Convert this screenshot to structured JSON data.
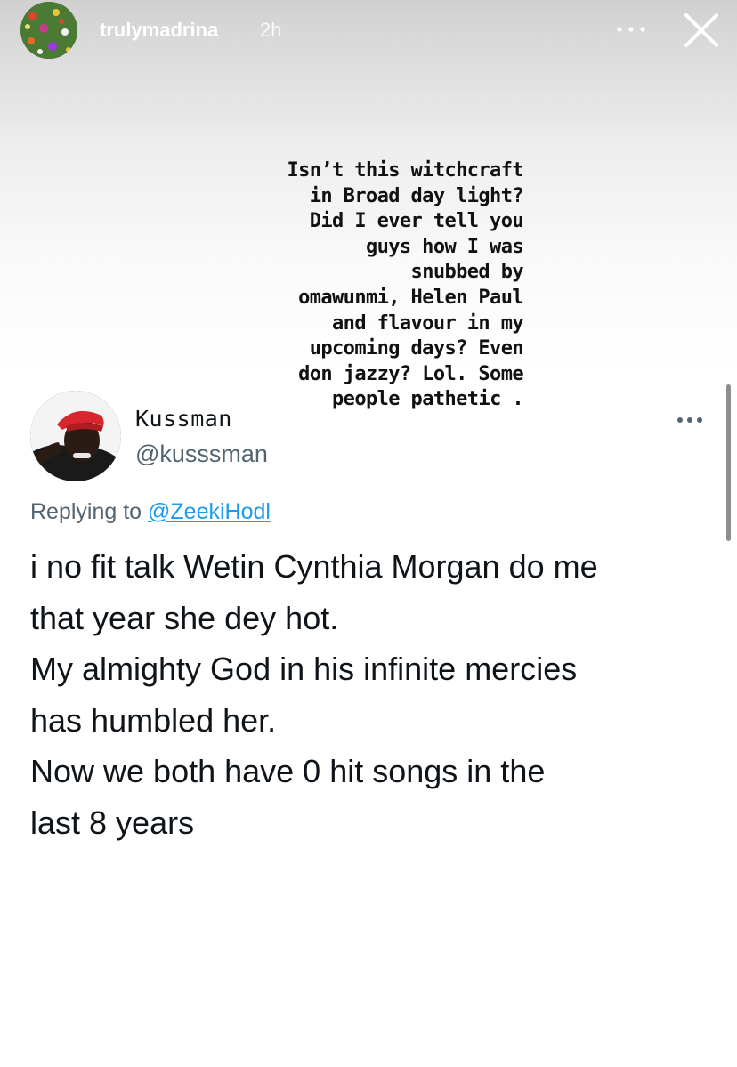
{
  "story": {
    "username": "trulymadrina",
    "time": "2h",
    "more_icon": "more-horizontal-icon",
    "close_icon": "close-icon"
  },
  "caption": {
    "lines": [
      "Isn’t this witchcraft",
      "in Broad day light?",
      "Did I ever tell you",
      "guys how I was",
      "snubbed by",
      "omawunmi, Helen Paul",
      "and flavour in my",
      "upcoming days? Even",
      "don jazzy? Lol. Some",
      "people pathetic ."
    ]
  },
  "tweet": {
    "display_name": "Kussman",
    "handle": "@kusssman",
    "replying_to_prefix": "Replying to",
    "replying_to_handle": "@ZeekiHodl",
    "body_lines": [
      "i no fit talk Wetin Cynthia Morgan do me",
      "that year she dey hot.",
      "My almighty God in his infinite mercies",
      "has humbled her.",
      "Now we both have 0 hit songs in the",
      "last 8 years"
    ]
  },
  "colors": {
    "text_primary": "#0f1419",
    "text_secondary": "#536471",
    "link": "#1d9bf0"
  }
}
